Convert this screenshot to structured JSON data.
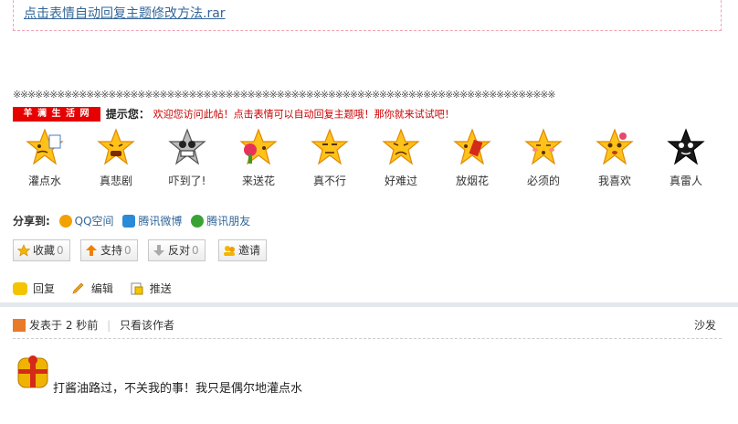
{
  "attachment": {
    "link_text": "点击表情自动回复主题修改方法.rar"
  },
  "separator": "※※※※※※※※※※※※※※※※※※※※※※※※※※※※※※※※※※※※※※※※※※※※※※※※※※※※※※※※※※※※※※※※※※※※※※※※※※",
  "hint": {
    "banner": "羊 澜 生 活 网",
    "label": "提示您：",
    "text": "欢迎您访问此帖！点击表情可以自动回复主题哦！那你就来试试吧！"
  },
  "emoticons": [
    {
      "label": "灌点水",
      "icon": "water-star-icon"
    },
    {
      "label": "真悲剧",
      "icon": "sad-star-icon"
    },
    {
      "label": "吓到了!",
      "icon": "skull-star-icon"
    },
    {
      "label": "来送花",
      "icon": "flower-star-icon"
    },
    {
      "label": "真不行",
      "icon": "unhappy-star-icon"
    },
    {
      "label": "好难过",
      "icon": "sorrow-star-icon"
    },
    {
      "label": "放烟花",
      "icon": "firework-star-icon"
    },
    {
      "label": "必须的",
      "icon": "blush-star-icon"
    },
    {
      "label": "我喜欢",
      "icon": "love-star-icon"
    },
    {
      "label": "真雷人",
      "icon": "black-star-icon"
    }
  ],
  "share": {
    "label": "分享到:",
    "items": [
      {
        "label": "QQ空间",
        "color": "#f2a100"
      },
      {
        "label": "腾讯微博",
        "color": "#2b8ad6"
      },
      {
        "label": "腾讯朋友",
        "color": "#3aa335"
      }
    ]
  },
  "buttons": [
    {
      "label": "收藏",
      "count": "0"
    },
    {
      "label": "支持",
      "count": "0"
    },
    {
      "label": "反对",
      "count": "0"
    },
    {
      "label": "邀请",
      "count": ""
    }
  ],
  "actions": [
    {
      "label": "回复"
    },
    {
      "label": "编辑"
    },
    {
      "label": "推送"
    }
  ],
  "post": {
    "posted_prefix": "发表于 2 秒前",
    "only_author": "只看该作者",
    "floor": "沙发",
    "content": "打酱油路过，不关我的事！我只是偶尔地灌点水"
  }
}
